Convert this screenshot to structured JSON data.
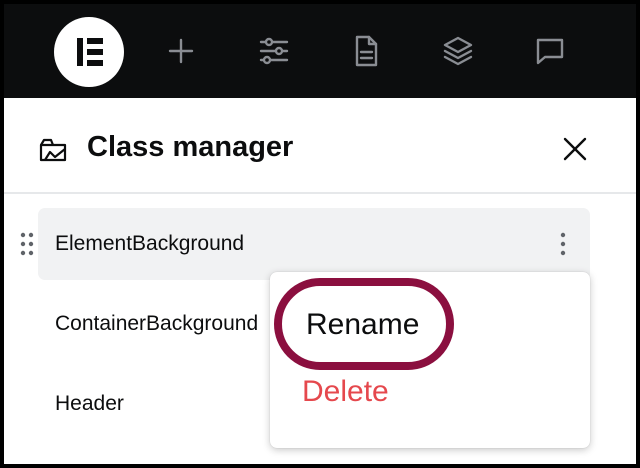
{
  "topbar": {
    "logo_icon": "elementor-logo-icon",
    "icons": [
      "plus-icon",
      "settings-sliders-icon",
      "page-document-icon",
      "layers-icon",
      "comment-icon"
    ],
    "icon_color": "#8a8d93"
  },
  "panel": {
    "title": "Class manager",
    "title_icon": "class-manager-icon",
    "close_icon": "close-icon"
  },
  "classes": [
    {
      "label": "ElementBackground"
    },
    {
      "label": "ContainerBackground"
    },
    {
      "label": "Header"
    }
  ],
  "menu": {
    "rename_label": "Rename",
    "delete_label": "Delete",
    "highlight_color": "#8b0f3f",
    "delete_color": "#e5484d"
  }
}
